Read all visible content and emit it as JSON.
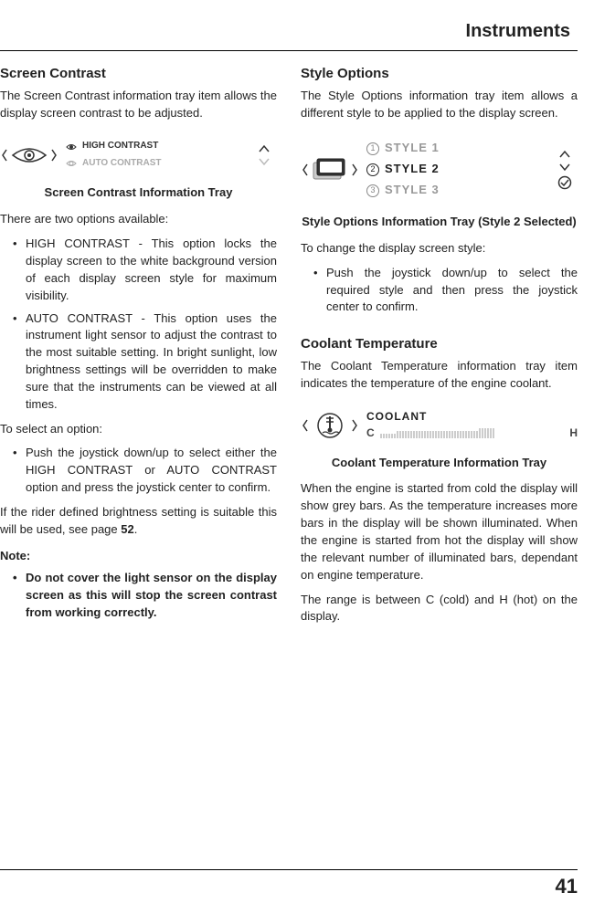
{
  "header": {
    "title": "Instruments"
  },
  "left": {
    "h_screen_contrast": "Screen Contrast",
    "p_intro": "The Screen Contrast information tray item allows the display screen contrast to be adjusted.",
    "tray": {
      "opt_high": "HIGH CONTRAST",
      "opt_auto": "AUTO CONTRAST"
    },
    "caption_contrast": "Screen Contrast Information Tray",
    "p_two_opts": "There are two options available:",
    "li_high": "HIGH CONTRAST - This option locks the display screen to the white background version of each display screen style for maximum visibility.",
    "li_auto": "AUTO CONTRAST - This option uses the instrument light sensor to adjust the contrast to the most suitable setting. In bright sunlight, low brightness settings will be overridden to make sure that the instruments can be viewed at all times.",
    "p_select": "To select an option:",
    "li_push": "Push the joystick down/up to select either the HIGH CONTRAST or AUTO CONTRAST option and press the joystick center to confirm.",
    "p_rider_pre": "If the rider defined brightness setting is suitable this will be used, see page ",
    "p_rider_page": "52",
    "p_rider_post": ".",
    "note_label": "Note:",
    "note_li": "Do not cover the light sensor on the display screen as this will stop the screen contrast from working correctly."
  },
  "right": {
    "h_style": "Style Options",
    "p_style_intro": "The Style Options information tray item allows a different style to be applied to the display screen.",
    "style_tray": {
      "n1": "1",
      "l1": "STYLE 1",
      "n2": "2",
      "l2": "STYLE 2",
      "n3": "3",
      "l3": "STYLE 3"
    },
    "caption_style": "Style Options Information Tray (Style 2 Selected)",
    "p_change": "To change the display screen style:",
    "li_style_push": "Push the joystick down/up to select the required style and then press the joystick center to confirm.",
    "h_coolant": "Coolant Temperature",
    "p_coolant_intro": "The Coolant Temperature information tray item indicates the temperature of the engine coolant.",
    "cool_tray": {
      "label": "COOLANT",
      "c": "C",
      "h": "H"
    },
    "caption_coolant": "Coolant Temperature Information Tray",
    "p_cool1": "When the engine is started from cold the display will show grey bars. As the temperature increases more bars in the display will be shown illuminated. When the engine is started from hot the display will show the relevant number of illuminated bars, dependant on engine temperature.",
    "p_cool2": "The range is between C (cold) and H (hot) on the display."
  },
  "pagenum": "41"
}
